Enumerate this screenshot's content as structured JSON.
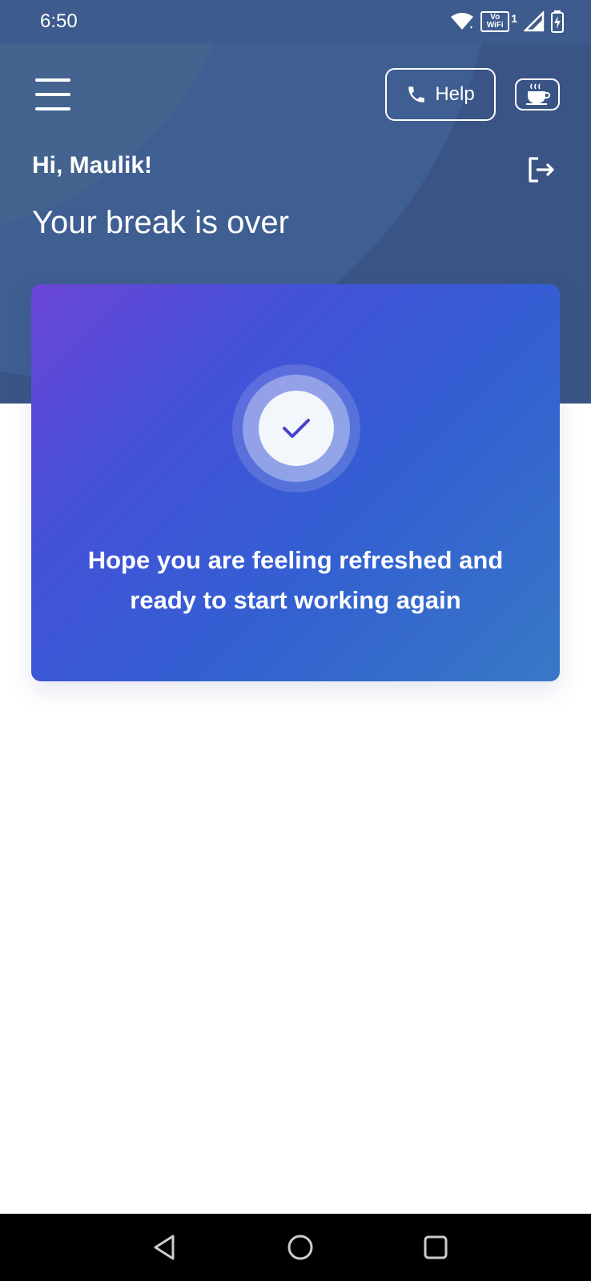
{
  "status_bar": {
    "time": "6:50",
    "vowifi_top": "Vo",
    "vowifi_bottom": "WiFi",
    "sim_number": "1",
    "icons": [
      "wifi-icon",
      "vowifi-icon",
      "signal-icon",
      "battery-charging-icon"
    ]
  },
  "header": {
    "menu_icon": "hamburger-menu-icon",
    "help_label": "Help",
    "help_icon": "phone-icon",
    "coffee_icon": "coffee-cup-icon",
    "greeting": "Hi, Maulik!",
    "logout_icon": "logout-icon",
    "headline": "Your break is over"
  },
  "card": {
    "icon": "checkmark-icon",
    "message": "Hope you are feeling refreshed and ready to start working again"
  },
  "nav_bar": {
    "back_icon": "back-triangle-icon",
    "home_icon": "home-circle-icon",
    "recents_icon": "recents-square-icon"
  },
  "colors": {
    "header_bg": "#3a5585",
    "card_gradient_start": "#6b45d6",
    "card_gradient_end": "#3878c6",
    "check_color": "#4a44c8"
  }
}
